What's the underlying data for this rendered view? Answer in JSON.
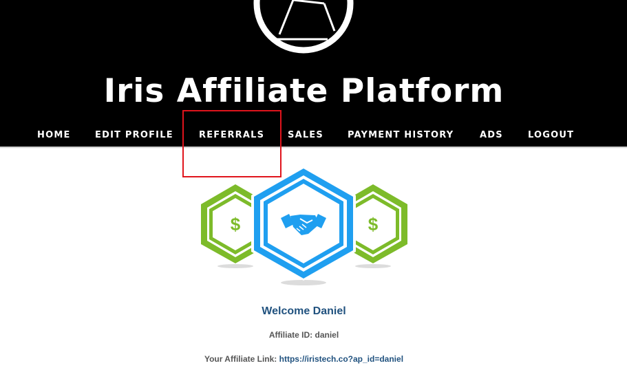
{
  "site": {
    "title": "Iris Affiliate Platform"
  },
  "nav": {
    "items": [
      {
        "label": "HOME"
      },
      {
        "label": "EDIT PROFILE"
      },
      {
        "label": "REFERRALS"
      },
      {
        "label": "SALES"
      },
      {
        "label": "PAYMENT HISTORY"
      },
      {
        "label": "ADS"
      },
      {
        "label": "LOGOUT"
      }
    ]
  },
  "icons": {
    "logo": "aperture-icon",
    "left_badge": "dollar-icon",
    "center_badge": "handshake-icon",
    "right_badge": "dollar-icon",
    "dollar_symbol": "$"
  },
  "main": {
    "welcome": "Welcome Daniel",
    "affiliate_id_label": "Affiliate ID:",
    "affiliate_id_value": "daniel",
    "affiliate_link_label": "Your Affiliate Link:",
    "affiliate_link_value": "https://iristech.co?ap_id=daniel"
  },
  "colors": {
    "header_bg": "#000000",
    "accent_green": "#7dbb2a",
    "accent_blue": "#1f9ff0",
    "link_blue": "#21527f",
    "highlight_red": "#e0141c"
  }
}
